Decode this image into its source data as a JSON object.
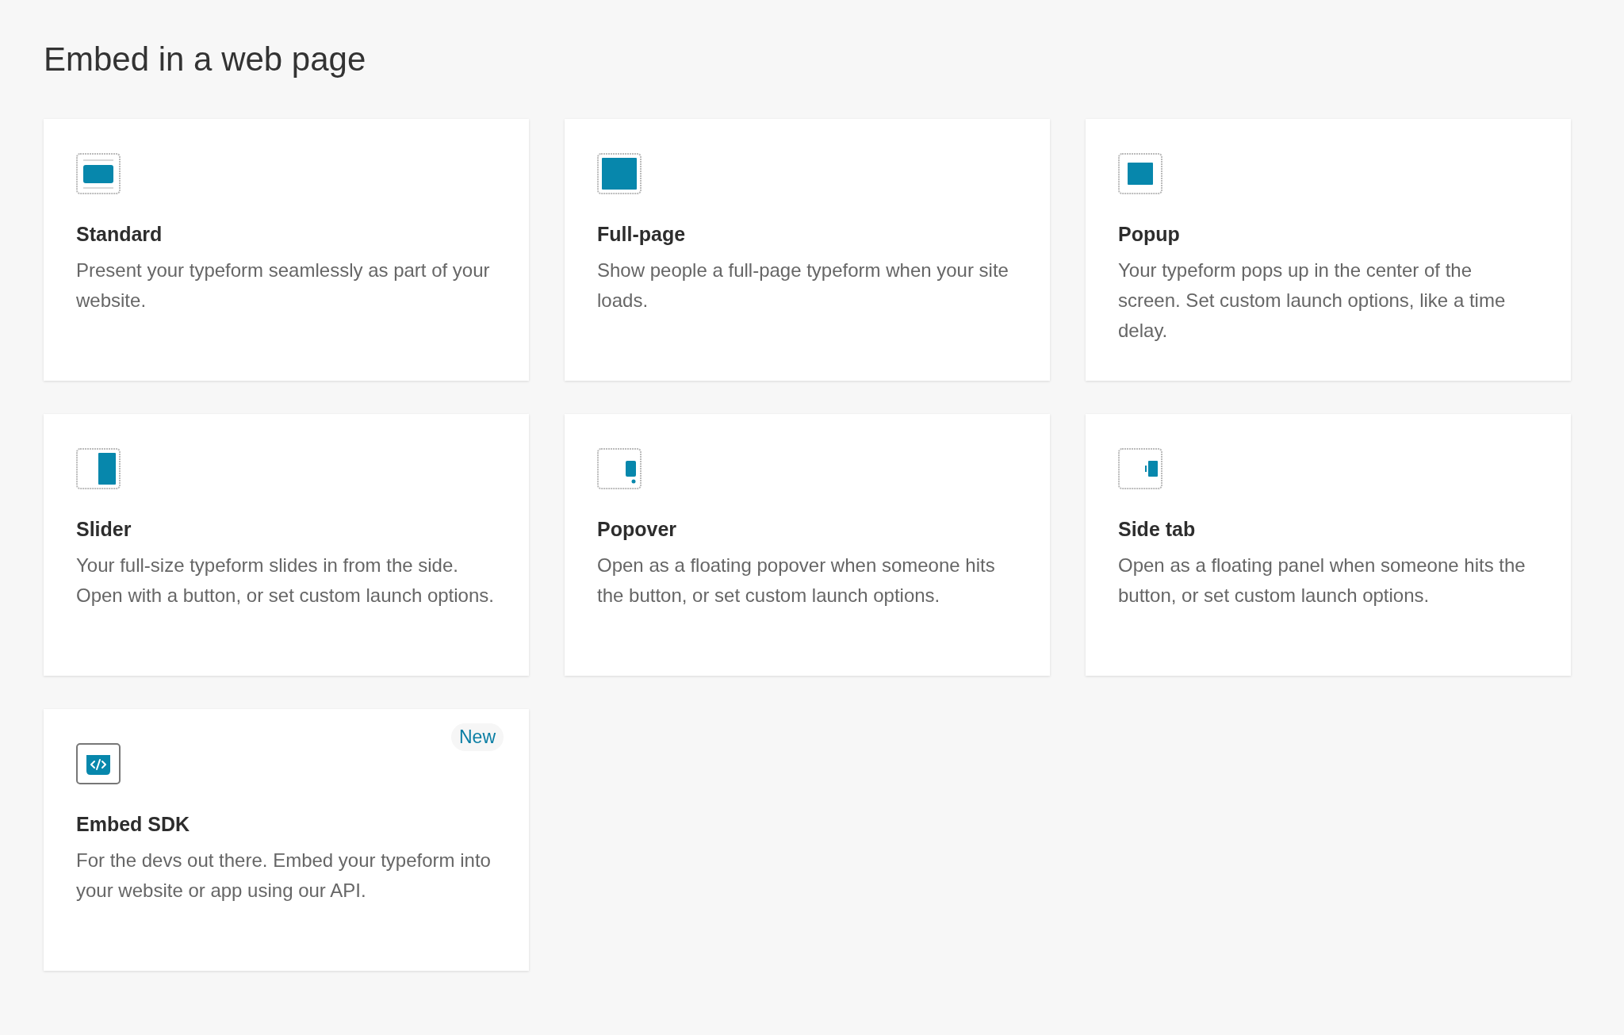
{
  "title": "Embed in a web page",
  "cards": [
    {
      "kind": "standard",
      "name": "Standard",
      "description": "Present your typeform seamlessly as part of your website."
    },
    {
      "kind": "full-page",
      "name": "Full-page",
      "description": "Show people a full-page typeform when your site loads."
    },
    {
      "kind": "popup",
      "name": "Popup",
      "description": "Your typeform pops up in the center of the screen. Set custom launch options, like a time delay."
    },
    {
      "kind": "slider",
      "name": "Slider",
      "description": "Your full-size typeform slides in from the side. Open with a button, or set custom launch options."
    },
    {
      "kind": "popover",
      "name": "Popover",
      "description": "Open as a floating popover when someone hits the button, or set custom launch options."
    },
    {
      "kind": "side-tab",
      "name": "Side tab",
      "description": "Open as a floating panel when someone hits the button, or set custom launch options."
    },
    {
      "kind": "sdk",
      "name": "Embed SDK",
      "description": "For the devs out there. Embed your typeform into your website or app using our API.",
      "badge": "New"
    }
  ]
}
